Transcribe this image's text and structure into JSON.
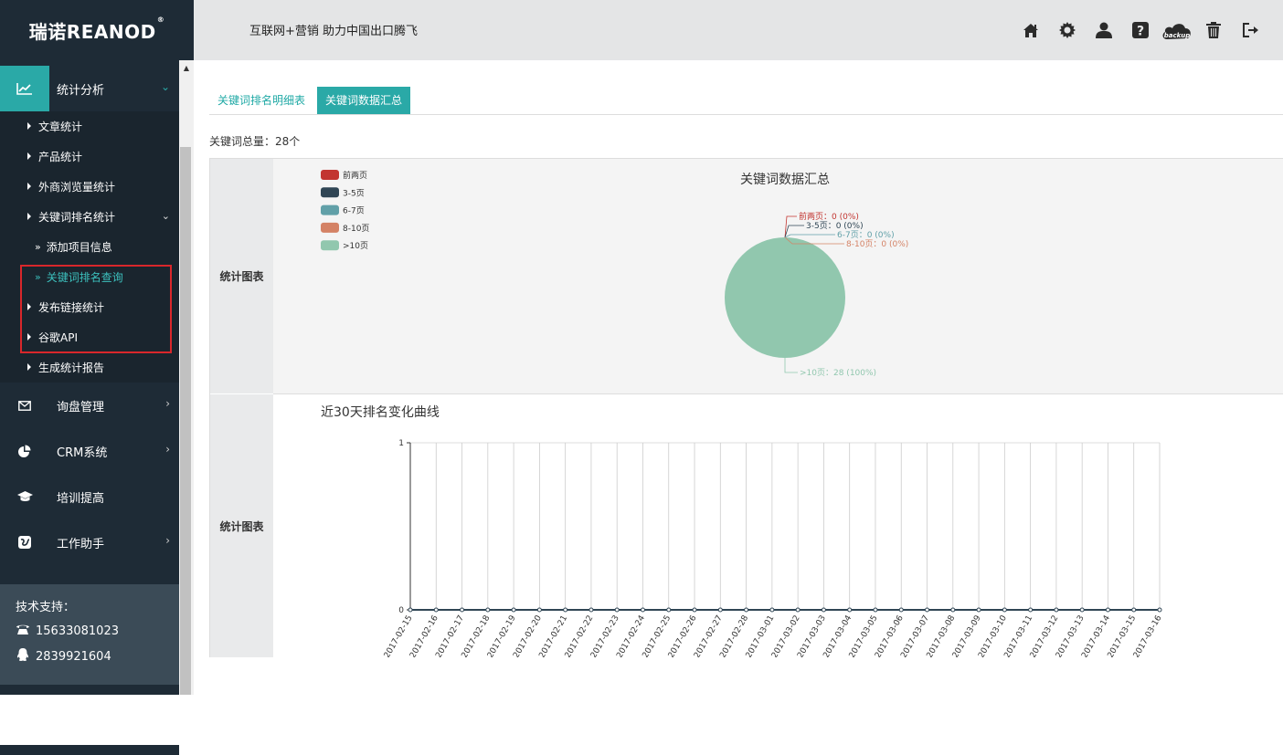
{
  "brand": {
    "logo": "瑞诺REANOD",
    "reg": "®"
  },
  "header": {
    "slogan": "互联网+营销  助力中国出口腾飞",
    "icons": [
      "home-icon",
      "gear-icon",
      "user-icon",
      "help-icon",
      "backup-cloud-icon",
      "trash-icon",
      "logout-icon"
    ],
    "backup_label": "backup"
  },
  "sidebar": {
    "stats": {
      "label": "统计分析",
      "items": [
        {
          "label": "文章统计"
        },
        {
          "label": "产品统计"
        },
        {
          "label": "外商浏览量统计"
        },
        {
          "label": "关键词排名统计",
          "children": [
            {
              "label": "添加项目信息"
            },
            {
              "label": "关键词排名查询"
            }
          ]
        },
        {
          "label": "发布链接统计"
        },
        {
          "label": "谷歌API"
        },
        {
          "label": "生成统计报告"
        }
      ]
    },
    "menus": [
      {
        "label": "询盘管理"
      },
      {
        "label": "CRM系统"
      },
      {
        "label": "培训提高"
      },
      {
        "label": "工作助手"
      }
    ],
    "support": {
      "heading": "技术支持：",
      "phone": "15633081023",
      "qq": "2839921604"
    }
  },
  "main": {
    "tabs": [
      {
        "label": "关键词排名明细表"
      },
      {
        "label": "关键词数据汇总"
      }
    ],
    "total": "关键词总量：28个",
    "row_label_1": "统计图表",
    "row_label_2": "统计图表"
  },
  "colors": {
    "accent": "#2aa9a7",
    "sidebar": "#1e2b36",
    "red_box": "#d9272b"
  },
  "chart_data": [
    {
      "type": "pie",
      "title": "关键词数据汇总",
      "labels": [
        "前两页",
        "3-5页",
        "6-7页",
        "8-10页",
        ">10页"
      ],
      "values": [
        0,
        0,
        0,
        0,
        28
      ],
      "slice_labels": [
        "前两页：0 (0%)",
        "3-5页：0 (0%)",
        "6-7页：0 (0%)",
        "8-10页：0 (0%)",
        ">10页：28 (100%)"
      ],
      "colors": [
        "#c23531",
        "#2f4554",
        "#61a0a8",
        "#d48265",
        "#91c7ae"
      ],
      "legend_position": "top-left"
    },
    {
      "type": "line",
      "title": "近30天排名变化曲线",
      "x": [
        "2017-02-15",
        "2017-02-16",
        "2017-02-17",
        "2017-02-18",
        "2017-02-19",
        "2017-02-20",
        "2017-02-21",
        "2017-02-22",
        "2017-02-23",
        "2017-02-24",
        "2017-02-25",
        "2017-02-26",
        "2017-02-27",
        "2017-02-28",
        "2017-03-01",
        "2017-03-02",
        "2017-03-03",
        "2017-03-04",
        "2017-03-05",
        "2017-03-06",
        "2017-03-07",
        "2017-03-08",
        "2017-03-09",
        "2017-03-10",
        "2017-03-11",
        "2017-03-12",
        "2017-03-13",
        "2017-03-14",
        "2017-03-15",
        "2017-03-16"
      ],
      "values": [
        0,
        0,
        0,
        0,
        0,
        0,
        0,
        0,
        0,
        0,
        0,
        0,
        0,
        0,
        0,
        0,
        0,
        0,
        0,
        0,
        0,
        0,
        0,
        0,
        0,
        0,
        0,
        0,
        0,
        0
      ],
      "ylim": [
        0,
        1
      ],
      "yticks": [
        "0",
        "1"
      ],
      "grid": true,
      "line_color": "#2f4554"
    }
  ]
}
